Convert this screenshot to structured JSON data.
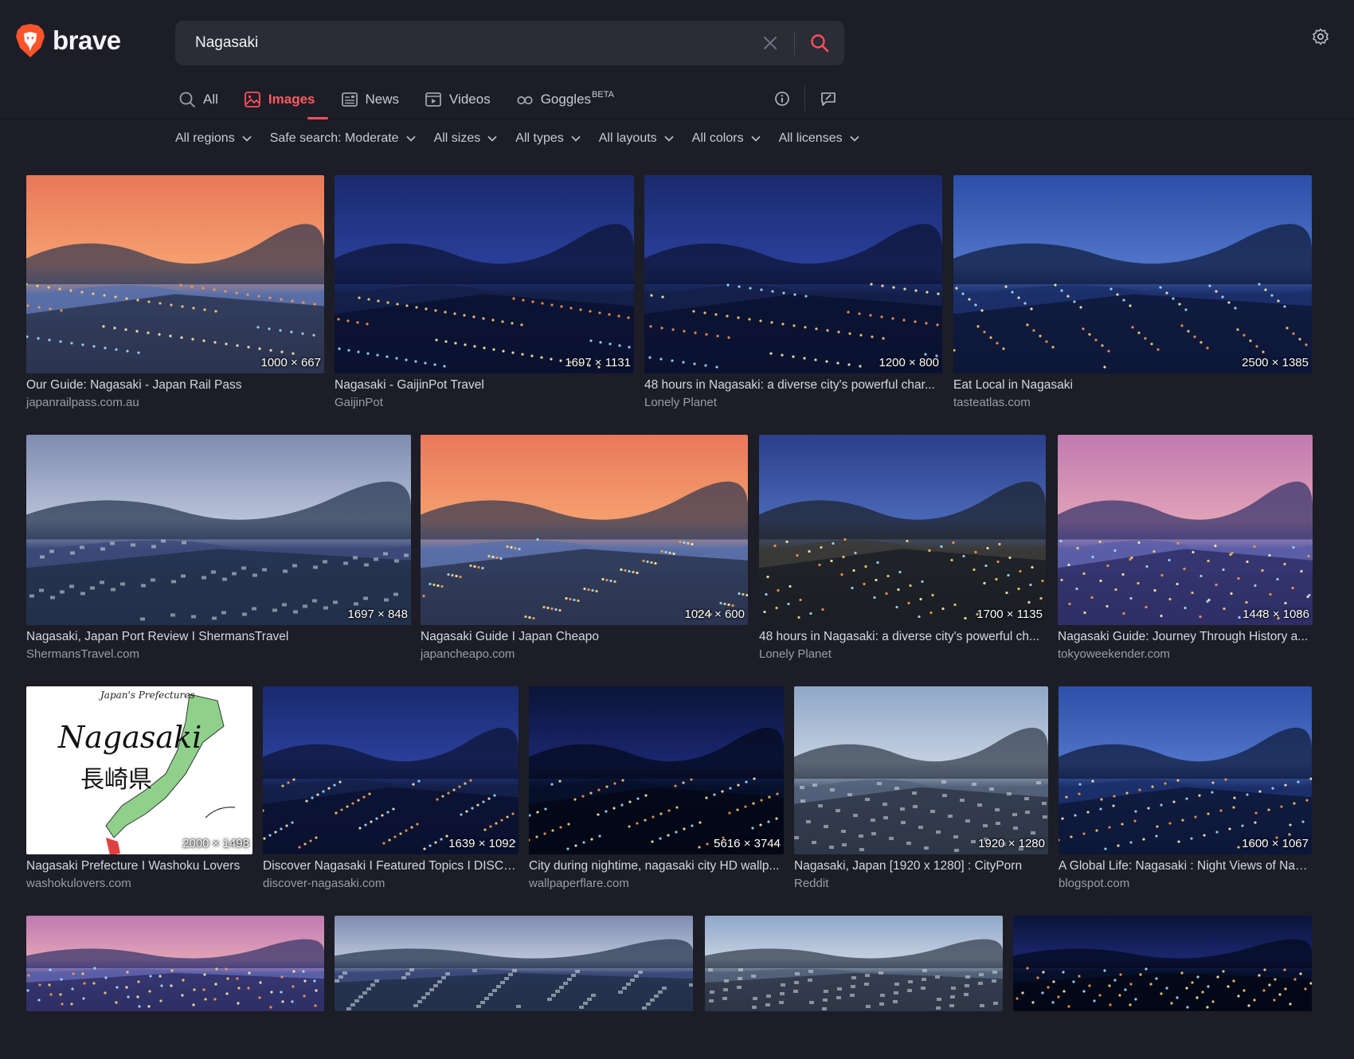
{
  "brand": {
    "name": "brave"
  },
  "search": {
    "query": "Nagasaki",
    "placeholder": ""
  },
  "tabs": [
    {
      "label": "All",
      "icon": "search-icon"
    },
    {
      "label": "Images",
      "icon": "image-icon",
      "active": true
    },
    {
      "label": "News",
      "icon": "news-icon"
    },
    {
      "label": "Videos",
      "icon": "video-icon"
    },
    {
      "label": "Goggles",
      "icon": "goggles-icon",
      "badge": "BETA"
    }
  ],
  "filters": [
    "All regions",
    "Safe search: Moderate",
    "All sizes",
    "All types",
    "All layouts",
    "All colors",
    "All licenses"
  ],
  "colors": {
    "accent": "#ff4f5a",
    "background": "#1c1d26",
    "searchbox": "#2a2c36"
  },
  "results": [
    {
      "title": "Our Guide: Nagasaki - Japan Rail Pass",
      "source": "japanrailpass.com.au",
      "dims": "1000 × 667",
      "scene": "sunset"
    },
    {
      "title": "Nagasaki - GaijinPot Travel",
      "source": "GaijinPot",
      "dims": "1697 × 1131",
      "scene": "night"
    },
    {
      "title": "48 hours in Nagasaki: a diverse city's powerful char...",
      "source": "Lonely Planet",
      "dims": "1200 × 800",
      "scene": "night"
    },
    {
      "title": "Eat Local in Nagasaki",
      "source": "tasteatlas.com",
      "dims": "2500 × 1385",
      "scene": "dusk"
    },
    {
      "title": "Nagasaki, Japan Port Review I ShermansTravel",
      "source": "ShermansTravel.com",
      "dims": "1697 × 848",
      "scene": "cloudy"
    },
    {
      "title": "Nagasaki Guide I Japan Cheapo",
      "source": "japancheapo.com",
      "dims": "1024 × 600",
      "scene": "sunset"
    },
    {
      "title": "48 hours in Nagasaki: a diverse city's powerful ch...",
      "source": "Lonely Planet",
      "dims": "1700 × 1135",
      "scene": "bridge"
    },
    {
      "title": "Nagasaki Guide: Journey Through History a...",
      "source": "tokyoweekender.com",
      "dims": "1448 × 1086",
      "scene": "purple"
    },
    {
      "title": "Nagasaki Prefecture I Washoku Lovers",
      "source": "washokulovers.com",
      "dims": "2000 × 1498",
      "scene": "map",
      "map_top": "Japan's Prefectures",
      "map_name": "Nagasaki",
      "map_kanji": "長崎県"
    },
    {
      "title": "Discover Nagasaki I Featured Topics I DISCO...",
      "source": "discover-nagasaki.com",
      "dims": "1639 × 1092",
      "scene": "night"
    },
    {
      "title": "City during nightime, nagasaki city HD wallp...",
      "source": "wallpaperflare.com",
      "dims": "5616 × 3744",
      "scene": "deepnight"
    },
    {
      "title": "Nagasaki, Japan [1920 x 1280] : CityPorn",
      "source": "Reddit",
      "dims": "1920 × 1280",
      "scene": "day"
    },
    {
      "title": "A Global Life: Nagasaki : Night Views of Nag...",
      "source": "blogspot.com",
      "dims": "1600 × 1067",
      "scene": "dusk"
    },
    {
      "scene": "purple"
    },
    {
      "scene": "cloudy"
    },
    {
      "scene": "day"
    },
    {
      "scene": "deepnight"
    }
  ]
}
